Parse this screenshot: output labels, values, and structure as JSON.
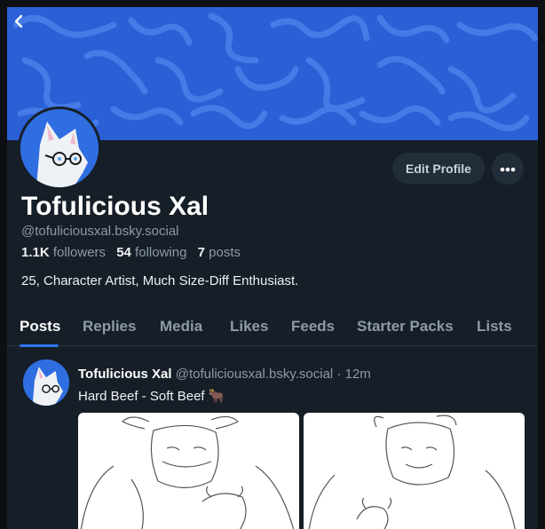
{
  "profile": {
    "display_name": "Tofulicious Xal",
    "handle": "@tofuliciousxal.bsky.social",
    "bio": "25, Character Artist, Much Size-Diff Enthusiast."
  },
  "stats": {
    "followers_count": "1.1K",
    "followers_label": "followers",
    "following_count": "54",
    "following_label": "following",
    "posts_count": "7",
    "posts_label": "posts"
  },
  "actions": {
    "edit_profile_label": "Edit Profile"
  },
  "tabs": [
    {
      "label": "Posts",
      "active": true
    },
    {
      "label": "Replies"
    },
    {
      "label": "Media"
    },
    {
      "label": "Likes"
    },
    {
      "label": "Feeds"
    },
    {
      "label": "Starter Packs"
    },
    {
      "label": "Lists"
    }
  ],
  "post": {
    "author": "Tofulicious Xal",
    "handle": "@tofuliciousxal.bsky.social",
    "separator": "·",
    "time": "12m",
    "text": "Hard Beef - Soft Beef 🐂"
  },
  "colors": {
    "banner": "#2a5fd6",
    "accent": "#2f73f2",
    "background": "#161e27"
  },
  "icons": [
    "back-chevron-icon",
    "more-dots-icon"
  ]
}
